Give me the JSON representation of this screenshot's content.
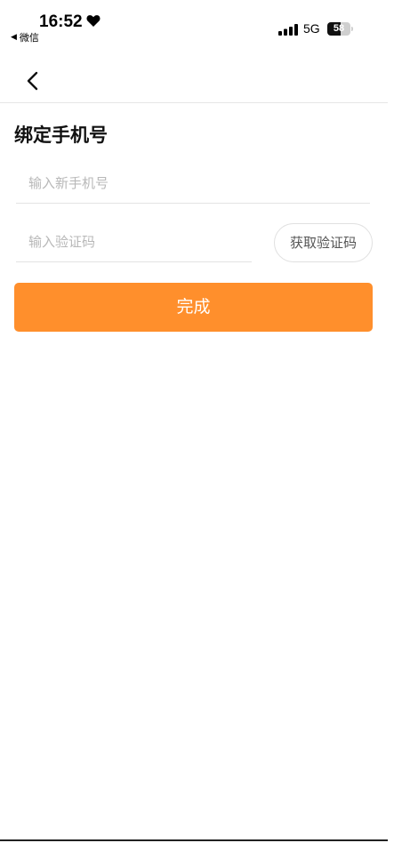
{
  "status_bar": {
    "time": "16:52",
    "back_app_label": "微信",
    "back_arrow": "◀",
    "network": "5G",
    "battery_level": "58",
    "battery_fraction": 0.58,
    "icons": [
      "heart-icon",
      "signal-icon",
      "battery-icon"
    ]
  },
  "nav": {
    "back_icon": "chevron-left-icon"
  },
  "page": {
    "title": "绑定手机号"
  },
  "form": {
    "phone_placeholder": "输入新手机号",
    "phone_value": "",
    "code_placeholder": "输入验证码",
    "code_value": "",
    "get_code_label": "获取验证码",
    "submit_label": "完成"
  },
  "colors": {
    "accent": "#ff8f2c",
    "divider": "#e6e6e6",
    "placeholder": "#b8b8b8"
  }
}
